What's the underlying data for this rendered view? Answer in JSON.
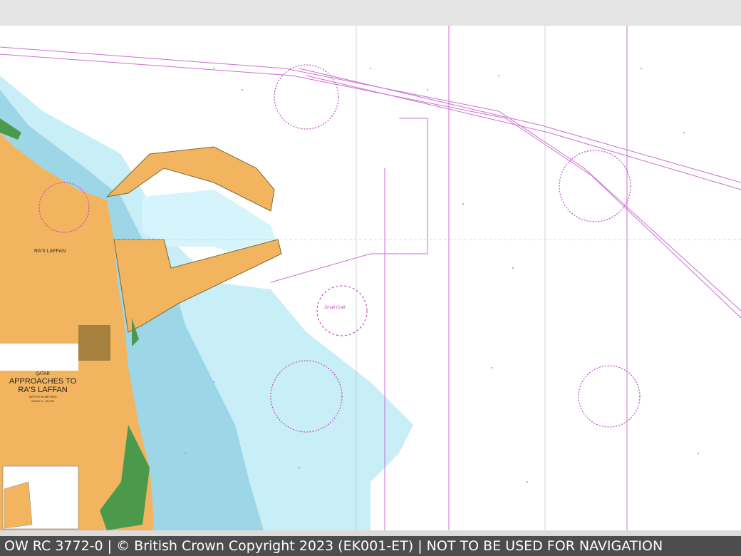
{
  "map": {
    "title_country": "QATAR",
    "title_line1": "APPROACHES TO",
    "title_line2": "RA'S LAFFAN",
    "subtitle": "DEPTHS IN METRES",
    "scale": "SCALE 1 : 25 000",
    "place_label": "RA'S LAFFAN",
    "area_label": "Small Craft",
    "colors": {
      "land": "#f2b25c",
      "deep_water": "#bfe6f0",
      "shallow_water": "#9fd4e3",
      "drying_green": "#4b9a4b",
      "sea": "#ffffff",
      "magenta": "#c04bc8",
      "footer_bg": "#4d4d4d"
    }
  },
  "footer": {
    "text": "OW RC 3772-0 | © British Crown Copyright 2023 (EK001-ET) | NOT TO BE USED FOR NAVIGATION"
  }
}
